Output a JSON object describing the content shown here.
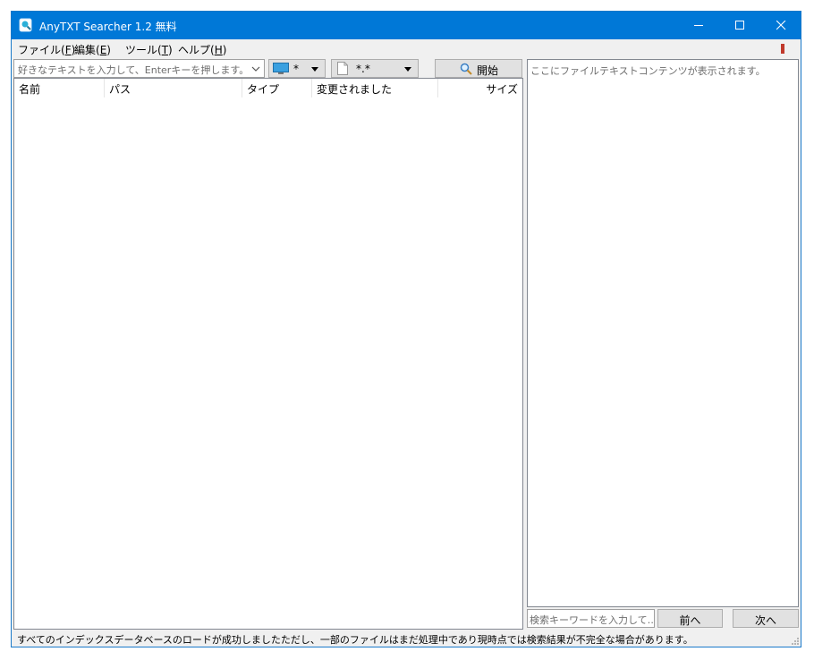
{
  "window": {
    "title": "AnyTXT Searcher 1.2 無料",
    "accent_color": "#0078d7",
    "controls": {
      "minimize_icon": "minimize-icon",
      "maximize_icon": "maximize-icon",
      "close_icon": "close-icon"
    }
  },
  "menu": [
    {
      "label": "ファイル(",
      "key": "F",
      "tail": ")"
    },
    {
      "label": "編集(",
      "key": "E",
      "tail": ")"
    },
    {
      "label": "ツール(",
      "key": "T",
      "tail": ")"
    },
    {
      "label": "ヘルプ(",
      "key": "H",
      "tail": ")"
    }
  ],
  "toolbar": {
    "search_placeholder": "好きなテキストを入力して、Enterキーを押します。",
    "drive_value": "*",
    "drive_icon": "monitor-icon",
    "filetype_value": "*.*",
    "filetype_icon": "document-icon",
    "start_label": "開始",
    "start_icon": "search-icon"
  },
  "columns": [
    "名前",
    "パス",
    "タイプ",
    "変更されました",
    "サイズ"
  ],
  "preview": {
    "placeholder": "ここにファイルテキストコンテンツが表示されます。"
  },
  "find": {
    "keyword_placeholder": "検索キーワードを入力して…",
    "prev_label": "前へ",
    "next_label": "次へ"
  },
  "status": {
    "text": "すべてのインデックスデータベースのロードが成功しましたただし、一部のファイルはまだ処理中であり現時点では検索結果が不完全な場合があります。"
  }
}
